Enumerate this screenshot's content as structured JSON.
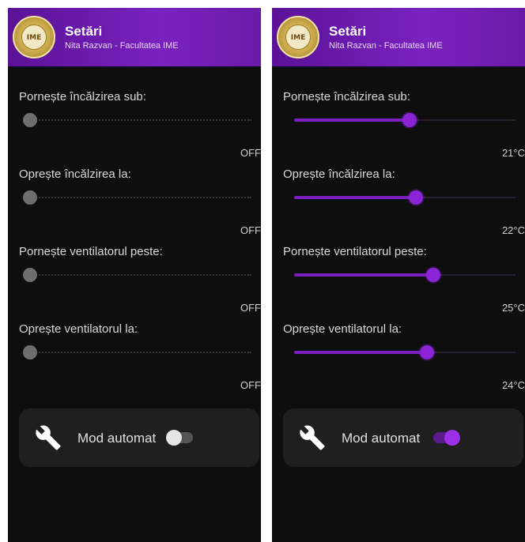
{
  "screens": [
    {
      "header": {
        "title": "Setări",
        "subtitle": "Nita Razvan - Facultatea IME",
        "logo_text": "IME"
      },
      "settings": [
        {
          "label": "Pornește încălzirea sub:",
          "value": "OFF",
          "level": 0
        },
        {
          "label": "Oprește încălzirea la:",
          "value": "OFF",
          "level": 0
        },
        {
          "label": "Pornește ventilatorul peste:",
          "value": "OFF",
          "level": 0
        },
        {
          "label": "Oprește ventilatorul la:",
          "value": "OFF",
          "level": 0
        }
      ],
      "auto_mode": {
        "label": "Mod automat",
        "enabled": false,
        "icon": "wrench-icon"
      }
    },
    {
      "header": {
        "title": "Setări",
        "subtitle": "Nita Razvan - Facultatea IME",
        "logo_text": "IME"
      },
      "settings": [
        {
          "label": "Pornește încălzirea sub:",
          "value": "21°C",
          "level": 0.52
        },
        {
          "label": "Oprește încălzirea la:",
          "value": "22°C",
          "level": 0.55
        },
        {
          "label": "Pornește ventilatorul peste:",
          "value": "25°C",
          "level": 0.63
        },
        {
          "label": "Oprește ventilatorul la:",
          "value": "24°C",
          "level": 0.6
        }
      ],
      "auto_mode": {
        "label": "Mod automat",
        "enabled": true,
        "icon": "wrench-icon"
      }
    }
  ],
  "colors": {
    "header_purple": "#6b1aa8",
    "accent": "#8a24d6",
    "background": "#0e0e0e",
    "card": "#1f1f1f"
  }
}
